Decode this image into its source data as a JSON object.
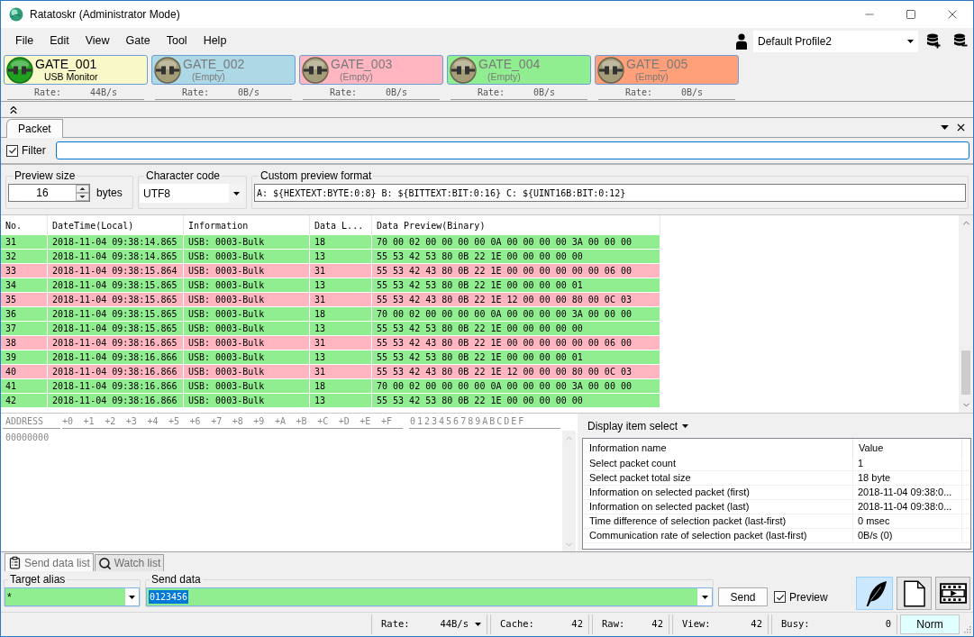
{
  "window": {
    "title": "Ratatoskr (Administrator Mode)"
  },
  "menu": [
    "File",
    "Edit",
    "View",
    "Gate",
    "Tool",
    "Help"
  ],
  "profile": {
    "value": "Default Profile2"
  },
  "gates": [
    {
      "name": "GATE_001",
      "description": "USB Monitor",
      "connected": true,
      "color": "#f8f8c8",
      "rate_label": "Rate:",
      "rate": "44B/s"
    },
    {
      "name": "GATE_002",
      "description": "(Empty)",
      "connected": false,
      "color": "#add8e6",
      "rate_label": "Rate:",
      "rate": "0B/s"
    },
    {
      "name": "GATE_003",
      "description": "(Empty)",
      "connected": false,
      "color": "#ffb6c1",
      "rate_label": "Rate:",
      "rate": "0B/s"
    },
    {
      "name": "GATE_004",
      "description": "(Empty)",
      "connected": false,
      "color": "#90ee90",
      "rate_label": "Rate:",
      "rate": "0B/s"
    },
    {
      "name": "GATE_005",
      "description": "(Empty)",
      "connected": false,
      "color": "#ffa07a",
      "rate_label": "Rate:",
      "rate": "0B/s"
    }
  ],
  "tabs": [
    {
      "label": "Packet",
      "selected": true
    }
  ],
  "filter": {
    "label": "Filter",
    "checked": true
  },
  "preview_size": {
    "label": "Preview size",
    "value": "16",
    "unit": "bytes"
  },
  "character_code": {
    "label": "Character code",
    "value": "UTF8"
  },
  "custom_preview_format": {
    "label": "Custom preview format",
    "value": "A: ${HEXTEXT:BYTE:0:8} B: ${BITTEXT:BIT:0:16} C: ${UINT16B:BIT:0:12}"
  },
  "packet_table": {
    "columns": [
      "No.",
      "DateTime(Local)",
      "Information",
      "Data L...",
      "Data Preview(Binary)"
    ],
    "rows": [
      {
        "color": "#90ee90",
        "cells": [
          "31",
          "2018-11-04 09:38:14.865",
          "USB: 0003-Bulk",
          "18",
          "70 00 02 00 00 00 00 0A 00 00 00 00 3A 00 00 00"
        ]
      },
      {
        "color": "#90ee90",
        "cells": [
          "32",
          "2018-11-04 09:38:14.865",
          "USB: 0003-Bulk",
          "13",
          "55 53 42 53 80 0B 22 1E 00 00 00 00 00"
        ]
      },
      {
        "color": "#ffb6c1",
        "cells": [
          "33",
          "2018-11-04 09:38:15.864",
          "USB: 0003-Bulk",
          "31",
          "55 53 42 43 80 0B 22 1E 00 00 00 00 00 00 06 00"
        ]
      },
      {
        "color": "#90ee90",
        "cells": [
          "34",
          "2018-11-04 09:38:15.865",
          "USB: 0003-Bulk",
          "13",
          "55 53 42 53 80 0B 22 1E 00 00 00 00 01"
        ]
      },
      {
        "color": "#ffb6c1",
        "cells": [
          "35",
          "2018-11-04 09:38:15.865",
          "USB: 0003-Bulk",
          "31",
          "55 53 42 43 80 0B 22 1E 12 00 00 00 80 00 0C 03"
        ]
      },
      {
        "color": "#90ee90",
        "cells": [
          "36",
          "2018-11-04 09:38:15.865",
          "USB: 0003-Bulk",
          "18",
          "70 00 02 00 00 00 00 0A 00 00 00 00 3A 00 00 00"
        ]
      },
      {
        "color": "#90ee90",
        "cells": [
          "37",
          "2018-11-04 09:38:15.865",
          "USB: 0003-Bulk",
          "13",
          "55 53 42 53 80 0B 22 1E 00 00 00 00 00"
        ]
      },
      {
        "color": "#ffb6c1",
        "cells": [
          "38",
          "2018-11-04 09:38:16.865",
          "USB: 0003-Bulk",
          "31",
          "55 53 42 43 80 0B 22 1E 00 00 00 00 00 00 06 00"
        ]
      },
      {
        "color": "#90ee90",
        "cells": [
          "39",
          "2018-11-04 09:38:16.866",
          "USB: 0003-Bulk",
          "13",
          "55 53 42 53 80 0B 22 1E 00 00 00 00 01"
        ]
      },
      {
        "color": "#ffb6c1",
        "cells": [
          "40",
          "2018-11-04 09:38:16.866",
          "USB: 0003-Bulk",
          "31",
          "55 53 42 43 80 0B 22 1E 12 00 00 00 80 00 0C 03"
        ]
      },
      {
        "color": "#90ee90",
        "cells": [
          "41",
          "2018-11-04 09:38:16.866",
          "USB: 0003-Bulk",
          "18",
          "70 00 02 00 00 00 00 0A 00 00 00 00 3A 00 00 00"
        ]
      },
      {
        "color": "#90ee90",
        "cells": [
          "42",
          "2018-11-04 09:38:16.866",
          "USB: 0003-Bulk",
          "13",
          "55 53 42 53 80 0B 22 1E 00 00 00 00 00"
        ]
      }
    ]
  },
  "hex_view": {
    "address_header": "ADDRESS",
    "offset_headers": [
      "+0",
      "+1",
      "+2",
      "+3",
      "+4",
      "+5",
      "+6",
      "+7",
      "+8",
      "+9",
      "+A",
      "+B",
      "+C",
      "+D",
      "+E",
      "+F"
    ],
    "text_header": "0123456789ABCDEF",
    "rows": [
      {
        "address": "00000000"
      }
    ]
  },
  "info_panel": {
    "menu": "Display item select",
    "columns": [
      "Information name",
      "Value"
    ],
    "rows": [
      {
        "name": "Select packet count",
        "value": "1"
      },
      {
        "name": "Select packet total size",
        "value": "18 byte"
      },
      {
        "name": "Information on selected packet (first)",
        "value": "2018-11-04 09:38:0..."
      },
      {
        "name": "Information on selected packet (last)",
        "value": "2018-11-04 09:38:0..."
      },
      {
        "name": "Time difference of selection packet (last-first)",
        "value": "0 msec"
      },
      {
        "name": "Communication rate of selection packet (last-first)",
        "value": "0B/s (0)"
      }
    ]
  },
  "bottom_tabs": [
    {
      "label": "Send data list",
      "selected": true
    },
    {
      "label": "Watch list",
      "selected": false
    }
  ],
  "send": {
    "target_alias": {
      "label": "Target alias",
      "value": "*"
    },
    "send_data": {
      "label": "Send data",
      "value": "0123456",
      "highlighted": true
    },
    "send_button": "Send",
    "preview": {
      "label": "Preview",
      "checked": true
    }
  },
  "mode_buttons": [
    {
      "selected": true
    },
    {
      "selected": false
    },
    {
      "selected": false
    }
  ],
  "status_bar": {
    "items": [
      {
        "kind": "dropdown",
        "label": "Rate:",
        "value": "44B/s"
      },
      {
        "kind": "counter",
        "label": "Cache:",
        "value": "42"
      },
      {
        "kind": "counter",
        "label": "Raw:",
        "value": "42"
      },
      {
        "kind": "counter",
        "label": "View:",
        "value": "42"
      },
      {
        "kind": "counter",
        "label": "Busy:",
        "value": "0"
      }
    ],
    "mode": "Norm"
  }
}
